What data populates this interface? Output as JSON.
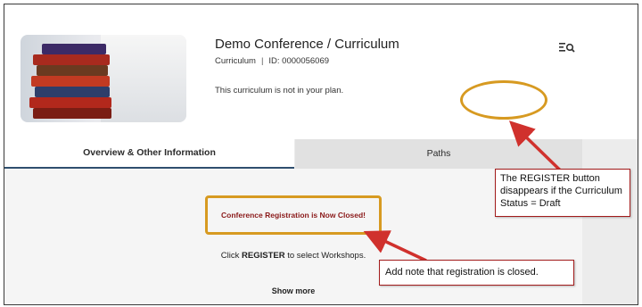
{
  "header": {
    "title": "Demo Conference / Curriculum",
    "type_label": "Curriculum",
    "separator": "|",
    "id_label": "ID: 0000056069",
    "plan_note": "This curriculum is not in your plan."
  },
  "icons": {
    "view": "view-list-search-icon",
    "thumbnail": "stacked-books-image"
  },
  "tabs": [
    {
      "label": "Overview & Other Information",
      "active": true
    },
    {
      "label": "Paths",
      "active": false
    }
  ],
  "content": {
    "closed_notice": "Conference Registration is Now Closed!",
    "register_prefix": "Click ",
    "register_keyword": "REGISTER",
    "register_suffix": " to select Workshops.",
    "show_more": "Show more"
  },
  "annotations": {
    "draft_note": "The REGISTER button disappears if the Curriculum Status = Draft",
    "closed_note": "Add note that registration is closed."
  },
  "colors": {
    "highlight": "#d79a21",
    "arrow": "#d0312d",
    "notice_text": "#8b1a1a",
    "tab_underline": "#2f4f6f"
  }
}
